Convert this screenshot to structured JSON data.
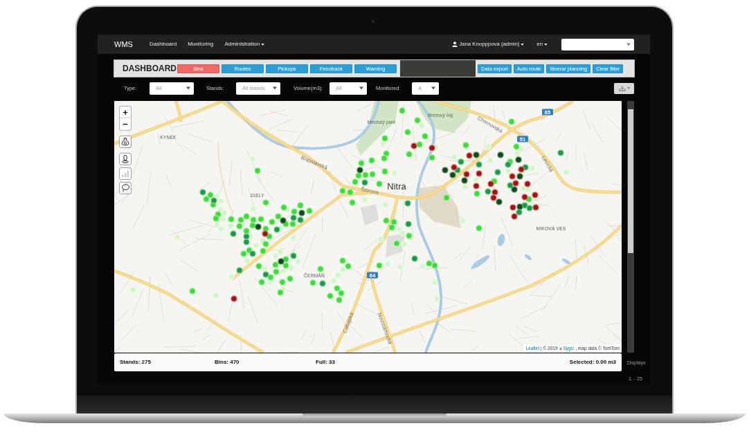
{
  "navbar": {
    "brand": "WMS",
    "links": [
      {
        "label": "Dashboard",
        "dropdown": false
      },
      {
        "label": "Monitoring",
        "dropdown": false
      },
      {
        "label": "Administration",
        "dropdown": true
      }
    ],
    "user": {
      "label": "Jana Knopppova (admin)",
      "dropdown": true
    },
    "language": {
      "label": "en",
      "dropdown": true
    }
  },
  "dashboard": {
    "title": "DASHBOARD",
    "tabs": [
      {
        "label": "Bins",
        "selected": true
      },
      {
        "label": "Routes",
        "selected": false
      },
      {
        "label": "Pickups",
        "selected": false
      },
      {
        "label": "Feedback",
        "selected": false
      },
      {
        "label": "Warning",
        "selected": false
      }
    ],
    "actions": [
      "Data export",
      "Auto route",
      "Itinerar planning",
      "Clear filter"
    ]
  },
  "filters": [
    {
      "label": "Type:",
      "value": "All"
    },
    {
      "label": "Stands:",
      "value": "All stands"
    },
    {
      "label": "Volume(m3):",
      "value": "All"
    },
    {
      "label": "Monitored:",
      "value": "A"
    }
  ],
  "map": {
    "zoom_in": "+",
    "zoom_out": "−",
    "tools": [
      {
        "kind": "bag",
        "disabled": false
      },
      {
        "kind": "bottle",
        "disabled": false
      },
      {
        "kind": "bar-chart",
        "disabled": true
      },
      {
        "kind": "lasso",
        "disabled": false
      }
    ],
    "labels": [
      {
        "kind": "district",
        "text": "KYNEK"
      },
      {
        "kind": "district",
        "text": "DIELY"
      },
      {
        "kind": "district",
        "text": "ČERMÁŇ"
      },
      {
        "kind": "city",
        "text": "Nitra"
      },
      {
        "kind": "park",
        "text": "Mestský park"
      },
      {
        "kind": "park",
        "text": "Brezový háj"
      },
      {
        "kind": "district",
        "text": "MIKOVÁ VES"
      },
      {
        "kind": "street",
        "text": "Bratislavská"
      },
      {
        "kind": "street",
        "text": "Štúrova"
      },
      {
        "kind": "street",
        "text": "Chrenovská"
      },
      {
        "kind": "street",
        "text": "Levická"
      },
      {
        "kind": "street",
        "text": "Cabajská"
      },
      {
        "kind": "street",
        "text": "Novozámocká"
      },
      {
        "kind": "road",
        "text": "65"
      },
      {
        "kind": "road",
        "text": "51"
      },
      {
        "kind": "road",
        "text": "64"
      }
    ],
    "attribution": [
      {
        "kind": "link",
        "text": "Leaflet"
      },
      {
        "kind": "text",
        "text": "| © 2019"
      },
      {
        "kind": "logo"
      },
      {
        "kind": "link",
        "text": "Sygic"
      },
      {
        "kind": "text",
        "text": ", map data © TomTom"
      }
    ]
  },
  "status_bar": [
    "Stands: 275",
    "Bins: 470",
    "Full: 33",
    "Selected: 0.00 m3"
  ],
  "side_panel": {
    "caption": "Displaye",
    "range": "1. - 25"
  }
}
